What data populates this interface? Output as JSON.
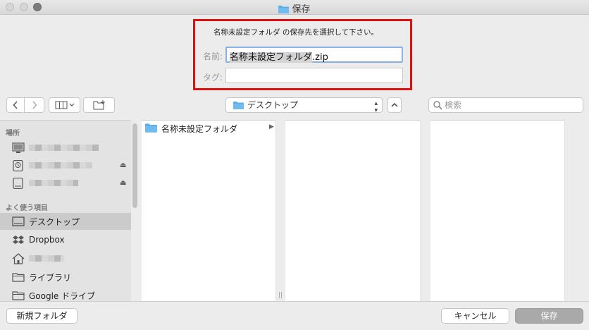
{
  "window": {
    "title": "保存"
  },
  "dialog": {
    "prompt": "名称未設定フォルダ の保存先を選択して下さい。",
    "name_label": "名前:",
    "name_value_selected": "名称未設定フォルダ",
    "name_value_ext": ".zip",
    "tag_label": "タグ:"
  },
  "toolbar": {
    "back_icon": "chevron-left-icon",
    "forward_icon": "chevron-right-icon",
    "view_icon": "column-view-icon",
    "new_folder_icon": "new-folder-icon",
    "location": "デスクトップ",
    "search_placeholder": "検索"
  },
  "sidebar": {
    "section_places": "場所",
    "section_favorites": "よく使う項目",
    "favorites": [
      {
        "label": "デスクトップ",
        "icon": "desktop-icon",
        "active": true
      },
      {
        "label": "Dropbox",
        "icon": "dropbox-icon"
      },
      {
        "label": "",
        "icon": "home-icon"
      },
      {
        "label": "ライブラリ",
        "icon": "folder-icon"
      },
      {
        "label": "Google ドライブ",
        "icon": "folder-icon"
      }
    ]
  },
  "browser": {
    "column1_items": [
      {
        "label": "名称未設定フォルダ",
        "icon": "folder-icon"
      }
    ]
  },
  "footer": {
    "new_folder": "新規フォルダ",
    "cancel": "キャンセル",
    "save": "保存"
  },
  "colors": {
    "highlight_border": "#e01010",
    "folder": "#5aaee8"
  }
}
